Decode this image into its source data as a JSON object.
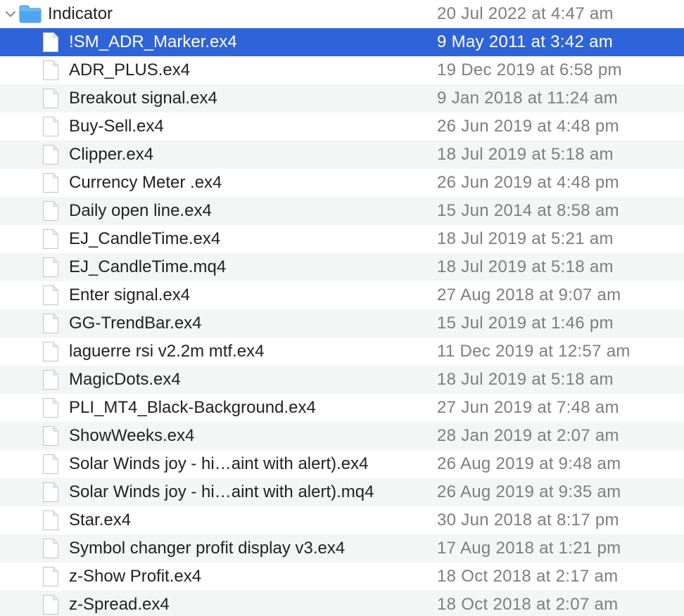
{
  "folder": {
    "name": "Indicator",
    "date": "20 Jul 2022 at 4:47 am",
    "icon": "folder-icon",
    "expanded": true
  },
  "colors": {
    "selection": "#2f63d8",
    "stripe": "#f4f5f5",
    "folder": "#4ea6f0",
    "date_text": "#7e7e7e"
  },
  "files": [
    {
      "name": "!SM_ADR_Marker.ex4",
      "date": "9 May 2011 at 3:42 am",
      "selected": true
    },
    {
      "name": "ADR_PLUS.ex4",
      "date": "19 Dec 2019 at 6:58 pm"
    },
    {
      "name": "Breakout signal.ex4",
      "date": "9 Jan 2018 at 11:24 am"
    },
    {
      "name": "Buy-Sell.ex4",
      "date": "26 Jun 2019 at 4:48 pm"
    },
    {
      "name": "Clipper.ex4",
      "date": "18 Jul 2019 at 5:18 am"
    },
    {
      "name": "Currency Meter .ex4",
      "date": "26 Jun 2019 at 4:48 pm"
    },
    {
      "name": "Daily open line.ex4",
      "date": "15 Jun 2014 at 8:58 am"
    },
    {
      "name": "EJ_CandleTime.ex4",
      "date": "18 Jul 2019 at 5:21 am"
    },
    {
      "name": "EJ_CandleTime.mq4",
      "date": "18 Jul 2019 at 5:18 am"
    },
    {
      "name": "Enter signal.ex4",
      "date": "27 Aug 2018 at 9:07 am"
    },
    {
      "name": "GG-TrendBar.ex4",
      "date": "15 Jul 2019 at 1:46 pm"
    },
    {
      "name": "laguerre rsi v2.2m mtf.ex4",
      "date": "11 Dec 2019 at 12:57 am"
    },
    {
      "name": "MagicDots.ex4",
      "date": "18 Jul 2019 at 5:18 am"
    },
    {
      "name": "PLI_MT4_Black-Background.ex4",
      "date": "27 Jun 2019 at 7:48 am"
    },
    {
      "name": "ShowWeeks.ex4",
      "date": "28 Jan 2019 at 2:07 am"
    },
    {
      "name": "Solar Winds joy - hi…aint with alert).ex4",
      "date": "26 Aug 2019 at 9:48 am"
    },
    {
      "name": "Solar Winds joy - hi…aint with alert).mq4",
      "date": "26 Aug 2019 at 9:35 am"
    },
    {
      "name": "Star.ex4",
      "date": "30 Jun 2018 at 8:17 pm"
    },
    {
      "name": "Symbol changer profit display v3.ex4",
      "date": "17 Aug 2018 at 1:21 pm"
    },
    {
      "name": "z-Show Profit.ex4",
      "date": "18 Oct 2018 at 2:17 am"
    },
    {
      "name": "z-Spread.ex4",
      "date": "18 Oct 2018 at 2:07 am"
    }
  ]
}
